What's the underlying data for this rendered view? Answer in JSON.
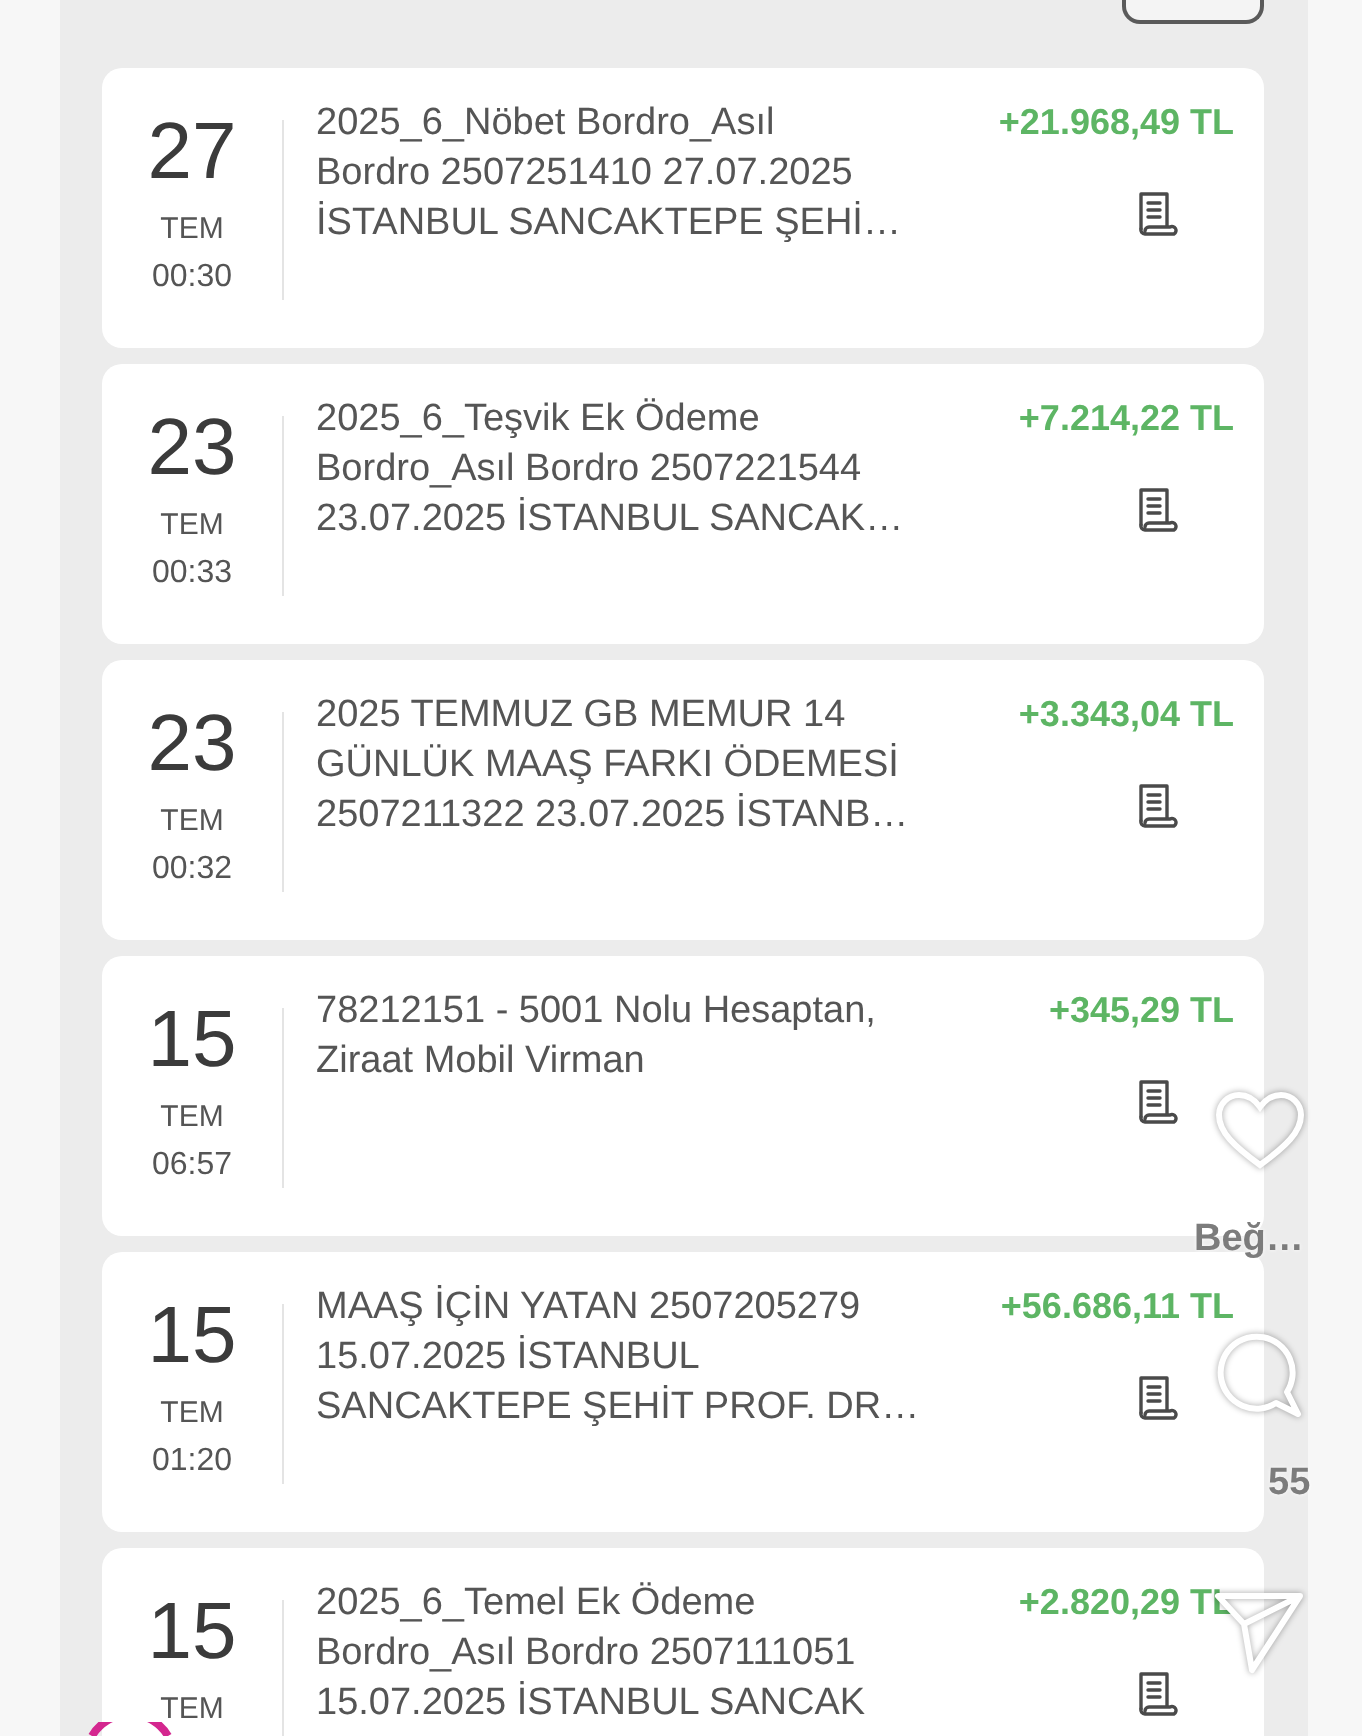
{
  "transactions": [
    {
      "day": "27",
      "month": "TEM",
      "time": "00:30",
      "description": [
        "2025_6_Nöbet Bordro_Asıl",
        "Bordro 2507251410 27.07.2025",
        "İSTANBUL SANCAKTEPE ŞEHİ…"
      ],
      "amount": "+21.968,49 TL"
    },
    {
      "day": "23",
      "month": "TEM",
      "time": "00:33",
      "description": [
        "2025_6_Teşvik Ek Ödeme",
        "Bordro_Asıl Bordro 2507221544",
        "23.07.2025 İSTANBUL SANCAK…"
      ],
      "amount": "+7.214,22 TL"
    },
    {
      "day": "23",
      "month": "TEM",
      "time": "00:32",
      "description": [
        "2025 TEMMUZ GB MEMUR 14",
        "GÜNLÜK MAAŞ FARKI ÖDEMESİ",
        "2507211322 23.07.2025 İSTANB…"
      ],
      "amount": "+3.343,04 TL"
    },
    {
      "day": "15",
      "month": "TEM",
      "time": "06:57",
      "description": [
        "78212151 - 5001 Nolu Hesaptan,",
        "Ziraat Mobil Virman"
      ],
      "amount": "+345,29 TL"
    },
    {
      "day": "15",
      "month": "TEM",
      "time": "01:20",
      "description": [
        "MAAŞ İÇİN YATAN 2507205279",
        "15.07.2025 İSTANBUL",
        "SANCAKTEPE ŞEHİT PROF. DR…"
      ],
      "amount": "+56.686,11 TL"
    },
    {
      "day": "15",
      "month": "TEM",
      "description": [
        "2025_6_Temel Ek Ödeme",
        "Bordro_Asıl Bordro 2507111051",
        "15.07.2025 İSTANBUL SANCAK"
      ],
      "amount": "+2.820,29 TL"
    }
  ],
  "overlay": {
    "like_label": "Beğ…",
    "comment_count": "55"
  }
}
